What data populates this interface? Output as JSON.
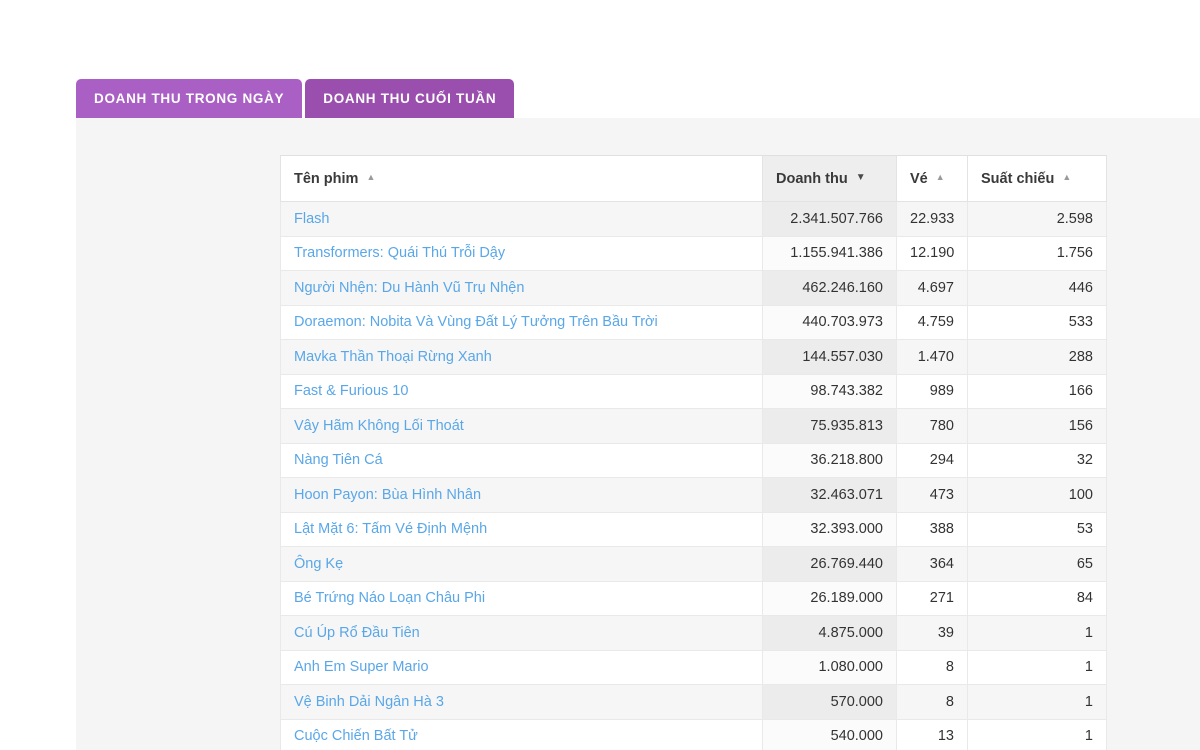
{
  "tabs": [
    {
      "label": "DOANH THU TRONG NGÀY",
      "state": "inactive",
      "name": "tab-doanh-thu-trong-ngay"
    },
    {
      "label": "DOANH THU CUỐI TUẦN",
      "state": "active",
      "name": "tab-doanh-thu-cuoi-tuan"
    }
  ],
  "colors": {
    "tab_inactive": "#a95fc4",
    "tab_active": "#9a4fae",
    "panel_background": "#f5f5f5",
    "link": "#5aa7e8",
    "sorted_header_background": "#eeeeee"
  },
  "table": {
    "columns": [
      {
        "label": "Tên phim",
        "sort": "asc",
        "sorted": false,
        "align": "left"
      },
      {
        "label": "Doanh thu",
        "sort": "desc",
        "sorted": true,
        "align": "right"
      },
      {
        "label": "Vé",
        "sort": "asc",
        "sorted": false,
        "align": "right"
      },
      {
        "label": "Suất chiếu",
        "sort": "asc",
        "sorted": false,
        "align": "right"
      }
    ],
    "sort_icons": {
      "asc": "▲",
      "desc": "▼"
    },
    "rows": [
      {
        "name": "Flash",
        "revenue": "2.341.507.766",
        "tickets": "22.933",
        "showtimes": "2.598"
      },
      {
        "name": "Transformers: Quái Thú Trỗi Dậy",
        "revenue": "1.155.941.386",
        "tickets": "12.190",
        "showtimes": "1.756"
      },
      {
        "name": "Người Nhện: Du Hành Vũ Trụ Nhện",
        "revenue": "462.246.160",
        "tickets": "4.697",
        "showtimes": "446"
      },
      {
        "name": "Doraemon: Nobita Và Vùng Đất Lý Tưởng Trên Bầu Trời",
        "revenue": "440.703.973",
        "tickets": "4.759",
        "showtimes": "533"
      },
      {
        "name": "Mavka Thần Thoại Rừng Xanh",
        "revenue": "144.557.030",
        "tickets": "1.470",
        "showtimes": "288"
      },
      {
        "name": "Fast & Furious 10",
        "revenue": "98.743.382",
        "tickets": "989",
        "showtimes": "166"
      },
      {
        "name": "Vây Hãm Không Lối Thoát",
        "revenue": "75.935.813",
        "tickets": "780",
        "showtimes": "156"
      },
      {
        "name": "Nàng Tiên Cá",
        "revenue": "36.218.800",
        "tickets": "294",
        "showtimes": "32"
      },
      {
        "name": "Hoon Payon: Bùa Hình Nhân",
        "revenue": "32.463.071",
        "tickets": "473",
        "showtimes": "100"
      },
      {
        "name": "Lật Mặt 6: Tấm Vé Định Mệnh",
        "revenue": "32.393.000",
        "tickets": "388",
        "showtimes": "53"
      },
      {
        "name": "Ông Kẹ",
        "revenue": "26.769.440",
        "tickets": "364",
        "showtimes": "65"
      },
      {
        "name": "Bé Trứng Náo Loạn Châu Phi",
        "revenue": "26.189.000",
        "tickets": "271",
        "showtimes": "84"
      },
      {
        "name": "Cú Úp Rổ Đầu Tiên",
        "revenue": "4.875.000",
        "tickets": "39",
        "showtimes": "1"
      },
      {
        "name": "Anh Em Super Mario",
        "revenue": "1.080.000",
        "tickets": "8",
        "showtimes": "1"
      },
      {
        "name": "Vệ Binh Dải Ngân Hà 3",
        "revenue": "570.000",
        "tickets": "8",
        "showtimes": "1"
      },
      {
        "name": "Cuộc Chiến Bất Tử",
        "revenue": "540.000",
        "tickets": "13",
        "showtimes": "1"
      }
    ]
  }
}
